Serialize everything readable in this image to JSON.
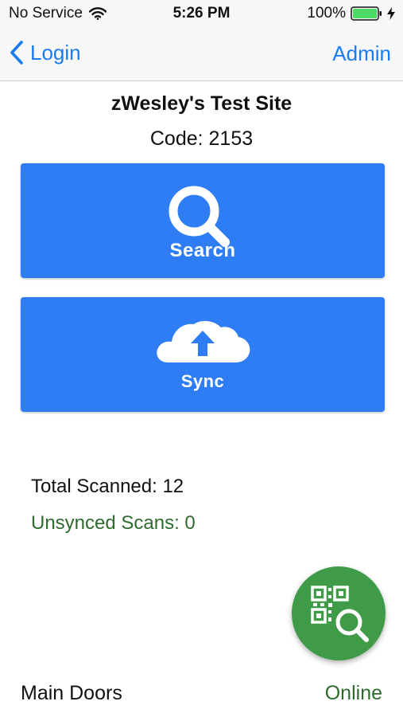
{
  "status_bar": {
    "carrier": "No Service",
    "time": "5:26 PM",
    "battery": "100%"
  },
  "nav": {
    "back_label": "Login",
    "right_label": "Admin"
  },
  "site": {
    "name": "zWesley's Test Site",
    "code": "Code: 2153"
  },
  "actions": {
    "search_label": "Search",
    "sync_label": "Sync"
  },
  "stats": {
    "total_scanned": "Total Scanned: 12",
    "unsynced_scans": "Unsynced Scans: 0"
  },
  "footer": {
    "location": "Main Doors",
    "connection": "Online"
  },
  "colors": {
    "accent_blue": "#2f7df5",
    "nav_tint": "#1a7cf0",
    "fab_green": "#3f9b47",
    "status_green": "#2e6b2e"
  }
}
